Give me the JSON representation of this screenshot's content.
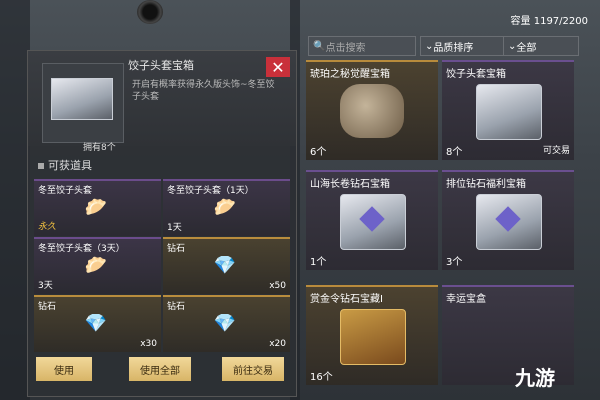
{
  "panel": {
    "title": "饺子头套宝箱",
    "description": "开启有概率获得永久版头饰~冬至饺子头套",
    "owned_label": "拥有8个",
    "close_icon": "close-icon",
    "section_title": "可获道具",
    "rewards": [
      {
        "name": "冬至饺子头套",
        "sub": "永久",
        "qty": "",
        "icon": "dumpling-icon",
        "rarity": "purple"
      },
      {
        "name": "冬至饺子头套（1天）",
        "sub": "1天",
        "qty": "",
        "icon": "dumpling-icon",
        "rarity": "purple"
      },
      {
        "name": "冬至饺子头套（3天）",
        "sub": "3天",
        "qty": "",
        "icon": "dumpling-icon",
        "rarity": "purple"
      },
      {
        "name": "钻石",
        "sub": "",
        "qty": "x50",
        "icon": "diamond-icon",
        "rarity": "gold"
      },
      {
        "name": "钻石",
        "sub": "",
        "qty": "x30",
        "icon": "diamond-icon",
        "rarity": "gold"
      },
      {
        "name": "钻石",
        "sub": "",
        "qty": "x20",
        "icon": "diamond-icon",
        "rarity": "gold"
      }
    ],
    "buttons": {
      "use": "使用",
      "use_all": "使用全部",
      "go_trade": "前往交易"
    }
  },
  "top": {
    "capacity": "容量 1197/2200"
  },
  "search": {
    "placeholder": "点击搜索"
  },
  "sort": {
    "label": "品质排序"
  },
  "filter": {
    "label": "全部"
  },
  "inventory": [
    {
      "name": "琥珀之秘觉醒宝箱",
      "count": "6个",
      "tag": "",
      "art": "helmet",
      "rarity": "gold"
    },
    {
      "name": "饺子头套宝箱",
      "count": "8个",
      "tag": "可交易",
      "art": "box",
      "rarity": "purple"
    },
    {
      "name": "山海长卷钻石宝箱",
      "count": "1个",
      "tag": "",
      "art": "box",
      "rarity": "purple"
    },
    {
      "name": "排位钻石福利宝箱",
      "count": "3个",
      "tag": "",
      "art": "box",
      "rarity": "purple"
    },
    {
      "name": "赏金令钻石宝藏I",
      "count": "16个",
      "tag": "",
      "art": "goldbox",
      "rarity": "gold"
    },
    {
      "name": "幸运宝盒",
      "count": "",
      "tag": "",
      "art": "",
      "rarity": "purple"
    }
  ],
  "logo": {
    "text": "九游"
  },
  "colors": {
    "accent_gold": "#d8b567",
    "accent_purple": "#6a4f8f",
    "close_red": "#c9303a"
  }
}
